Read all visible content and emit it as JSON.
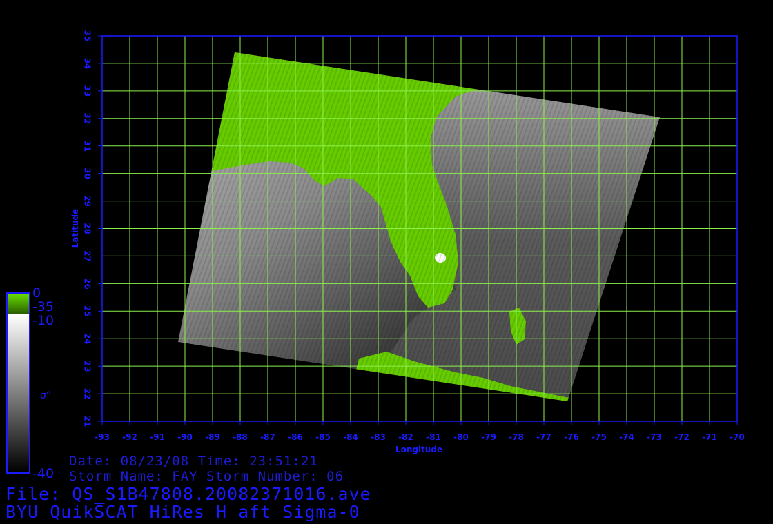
{
  "map": {
    "lon_range": [
      -93,
      -70
    ],
    "lat_range": [
      21,
      35
    ],
    "lon_ticks": [
      "-93",
      "-92",
      "-91",
      "-90",
      "-89",
      "-88",
      "-87",
      "-86",
      "-85",
      "-84",
      "-83",
      "-82",
      "-81",
      "-80",
      "-79",
      "-78",
      "-77",
      "-76",
      "-75",
      "-74",
      "-73",
      "-72",
      "-71",
      "-70"
    ],
    "lat_ticks": [
      "21",
      "22",
      "23",
      "24",
      "25",
      "26",
      "27",
      "28",
      "29",
      "30",
      "31",
      "32",
      "33",
      "34",
      "35"
    ],
    "x_axis_label": "Longitude",
    "y_axis_label": "Latitude",
    "grid": true,
    "grid_color": "#8cf04a",
    "axis_color": "#1a1aff",
    "land_color": "#66cc00",
    "ocean_palette": "grayscale"
  },
  "colorbar": {
    "land_top": "0",
    "land_bottom": "-35",
    "ocean_top": "-10",
    "ocean_bottom": "-40",
    "symbol": "σ°"
  },
  "annotations": {
    "date_time": "Date: 08/23/08  Time: 23:51:21",
    "storm": "Storm  Name: FAY   Storm  Number: 06",
    "file": "File: QS_S1B47808.20082371016.ave",
    "product": "BYU QuikSCAT HiRes H aft Sigma-0"
  }
}
